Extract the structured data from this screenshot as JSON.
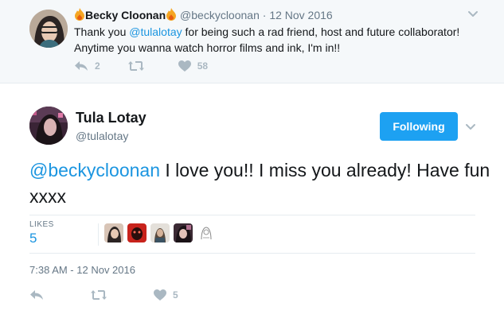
{
  "parent_tweet": {
    "display_name": "Becky Cloonan",
    "handle": "@beckycloonan",
    "separator": "·",
    "date": "12 Nov 2016",
    "text_before": "Thank you ",
    "mention": "@tulalotay",
    "text_after": " for being such a rad friend, host and future collaborator! Anytime you wanna watch horror films and ink, I'm in!!",
    "reply_count": "2",
    "retweet_count": "",
    "like_count": "58"
  },
  "main_tweet": {
    "display_name": "Tula Lotay",
    "handle": "@tulalotay",
    "follow_label": "Following",
    "mention": "@beckycloonan",
    "text": " I love you!! I miss you already! Have fun xxxx",
    "likes_label": "LIKES",
    "likes_count": "5",
    "timestamp": "7:38 AM - 12 Nov 2016",
    "like_count": "5"
  },
  "colors": {
    "accent": "#1da1f2",
    "link": "#1b95e0",
    "muted": "#657786",
    "icon": "#aab8c2",
    "flame": "#f5a623"
  },
  "icons": [
    "flame-icon",
    "chevron-down-icon",
    "reply-icon",
    "retweet-icon",
    "heart-icon"
  ]
}
